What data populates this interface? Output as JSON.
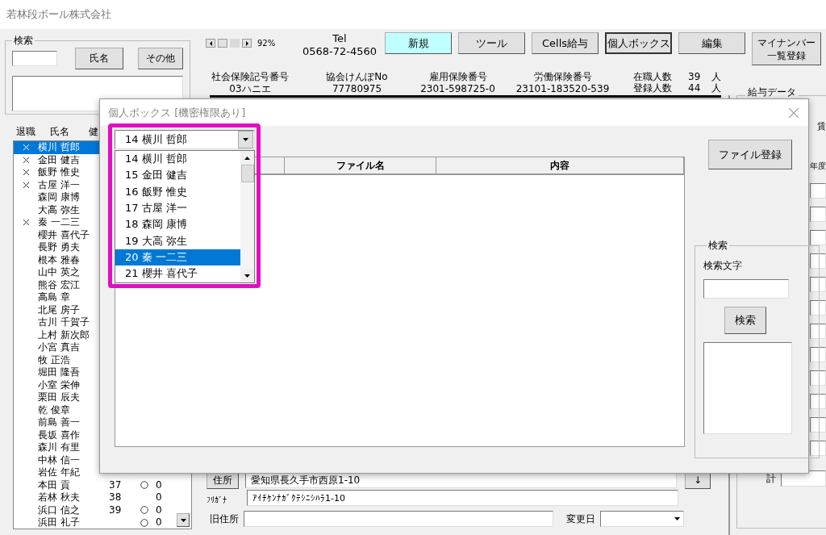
{
  "window": {
    "title": "若林段ボール株式会社"
  },
  "search_panel": {
    "title": "検索",
    "buttons": [
      "氏名",
      "その他"
    ]
  },
  "employee_list": {
    "columns": [
      "退職",
      "氏名",
      "健"
    ],
    "rows": [
      {
        "name": "横川 哲郎",
        "retired": true,
        "selected": true
      },
      {
        "name": "金田 健吉",
        "retired": true,
        "selected": false
      },
      {
        "name": "飯野 惟史",
        "retired": true,
        "selected": false
      },
      {
        "name": "古屋 洋一",
        "retired": true,
        "selected": false
      },
      {
        "name": "森岡 康博",
        "retired": false,
        "selected": false
      },
      {
        "name": "大高 弥生",
        "retired": false,
        "selected": false
      },
      {
        "name": "秦 一二三",
        "retired": true,
        "selected": false
      },
      {
        "name": "櫻井 喜代子",
        "retired": false,
        "selected": false
      },
      {
        "name": "長野 勇夫",
        "retired": false,
        "selected": false
      },
      {
        "name": "根本 雅春",
        "retired": false,
        "selected": false
      },
      {
        "name": "山中 英之",
        "retired": false,
        "selected": false
      },
      {
        "name": "熊谷 宏江",
        "retired": false,
        "selected": false
      },
      {
        "name": "高島 章",
        "retired": false,
        "selected": false
      },
      {
        "name": "北尾 房子",
        "retired": false,
        "selected": false
      },
      {
        "name": "古川 千賀子",
        "retired": false,
        "selected": false
      },
      {
        "name": "上村 新次郎",
        "retired": false,
        "selected": false
      },
      {
        "name": "小宮 真吉",
        "retired": false,
        "selected": false
      },
      {
        "name": "牧 正浩",
        "retired": false,
        "selected": false
      },
      {
        "name": "堀田 隆吾",
        "retired": false,
        "selected": false
      },
      {
        "name": "小室 栄伸",
        "retired": false,
        "selected": false
      },
      {
        "name": "栗田 辰夫",
        "retired": false,
        "selected": false
      },
      {
        "name": "乾 俊章",
        "retired": false,
        "selected": false
      },
      {
        "name": "前島 善一",
        "retired": false,
        "selected": false
      },
      {
        "name": "長坂 喜作",
        "retired": false,
        "selected": false
      },
      {
        "name": "森川 有里",
        "retired": false,
        "selected": false
      },
      {
        "name": "中林 信一",
        "retired": false,
        "selected": false
      },
      {
        "name": "岩佐 年紀",
        "retired": false,
        "selected": false
      },
      {
        "name": "本田 貢",
        "retired": false,
        "selected": false,
        "number": "37",
        "enrolled": true,
        "value": "0"
      },
      {
        "name": "若林 秋夫",
        "retired": false,
        "selected": false,
        "number": "38",
        "enrolled": false,
        "value": "0"
      },
      {
        "name": "浜口 信之",
        "retired": false,
        "selected": false,
        "number": "39",
        "enrolled": true,
        "value": "0"
      },
      {
        "name": "浜田 礼子",
        "retired": false,
        "selected": false,
        "enrolled": true,
        "value": "0"
      }
    ]
  },
  "toolbar": {
    "zoom": "92%",
    "tel_label": "Tel",
    "tel": "0568-72-4560",
    "buttons": [
      {
        "lines": [
          "新規"
        ],
        "highlighted": true,
        "focused": false
      },
      {
        "lines": [
          "ツール"
        ],
        "highlighted": false,
        "focused": false
      },
      {
        "lines": [
          "Cells給与"
        ],
        "highlighted": false,
        "focused": false
      },
      {
        "lines": [
          "個人ボックス"
        ],
        "highlighted": false,
        "focused": true
      },
      {
        "lines": [
          "編集"
        ],
        "highlighted": false,
        "focused": false
      },
      {
        "lines": [
          "マイナンバー",
          "一覧登録"
        ],
        "highlighted": false,
        "focused": false
      }
    ]
  },
  "info": [
    {
      "label": "社会保険記号番号",
      "value": "03ハニエ"
    },
    {
      "label": "協会けんぽNo",
      "value": "77780975"
    },
    {
      "label": "雇用保険番号",
      "value": "2301-598725-0"
    },
    {
      "label": "労働保険番号",
      "value": "23101-183520-539"
    }
  ],
  "counts": [
    {
      "label": "在職人数",
      "value": "39",
      "unit": "人"
    },
    {
      "label": "登録人数",
      "value": "44",
      "unit": "人"
    }
  ],
  "salary_panel": {
    "title": "給与データ",
    "tab": "賃",
    "year": "年度",
    "total_label": "計"
  },
  "address": {
    "button": "住所",
    "value": "愛知県長久手市西原1-10",
    "furigana_label": "ﾌﾘｶﾞﾅ",
    "furigana": "ｱｲﾁｹﾝﾅｶﾞｸﾃｼﾆｼﾊﾗ1-10",
    "arrow": "↓",
    "old_label": "旧住所",
    "date_label": "変更日"
  },
  "dialog": {
    "title": "個人ボックス [機密権限あり]",
    "combo_value": "14 横川 哲郎",
    "dropdown": [
      {
        "label": "14 横川 哲郎",
        "selected": false
      },
      {
        "label": "15 金田 健吉",
        "selected": false
      },
      {
        "label": "16 飯野 惟史",
        "selected": false
      },
      {
        "label": "17 古屋 洋一",
        "selected": false
      },
      {
        "label": "18 森岡 康博",
        "selected": false
      },
      {
        "label": "19 大高 弥生",
        "selected": false
      },
      {
        "label": "20 秦 一二三",
        "selected": true
      },
      {
        "label": "21 櫻井 喜代子",
        "selected": false
      }
    ],
    "table_columns": [
      "ファイル名",
      "内容"
    ],
    "register_button": "ファイル登録",
    "search": {
      "title": "検索",
      "label": "検索文字",
      "button": "検索"
    }
  }
}
